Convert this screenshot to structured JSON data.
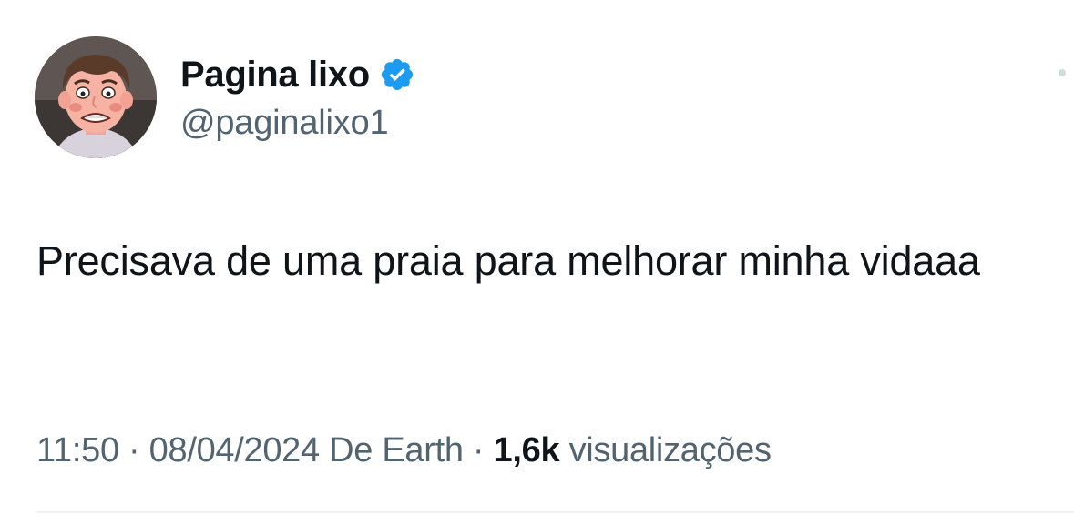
{
  "author": {
    "display_name": "Pagina lixo",
    "handle": "@paginalixo1",
    "verified": true,
    "avatar_icon": "cartoon-man-avatar",
    "verified_icon": "verified-badge-icon"
  },
  "tweet": {
    "text": "Precisava de uma praia para melhorar minha vidaaa"
  },
  "meta": {
    "time": "11:50",
    "separator": " · ",
    "date": "08/04/2024",
    "source": "De Earth",
    "views_count": "1,6k",
    "views_label": "visualizações"
  },
  "colors": {
    "text_primary": "#0f1419",
    "text_secondary": "#536471",
    "verified_blue": "#1d9bf0",
    "divider": "#eff3f4"
  }
}
